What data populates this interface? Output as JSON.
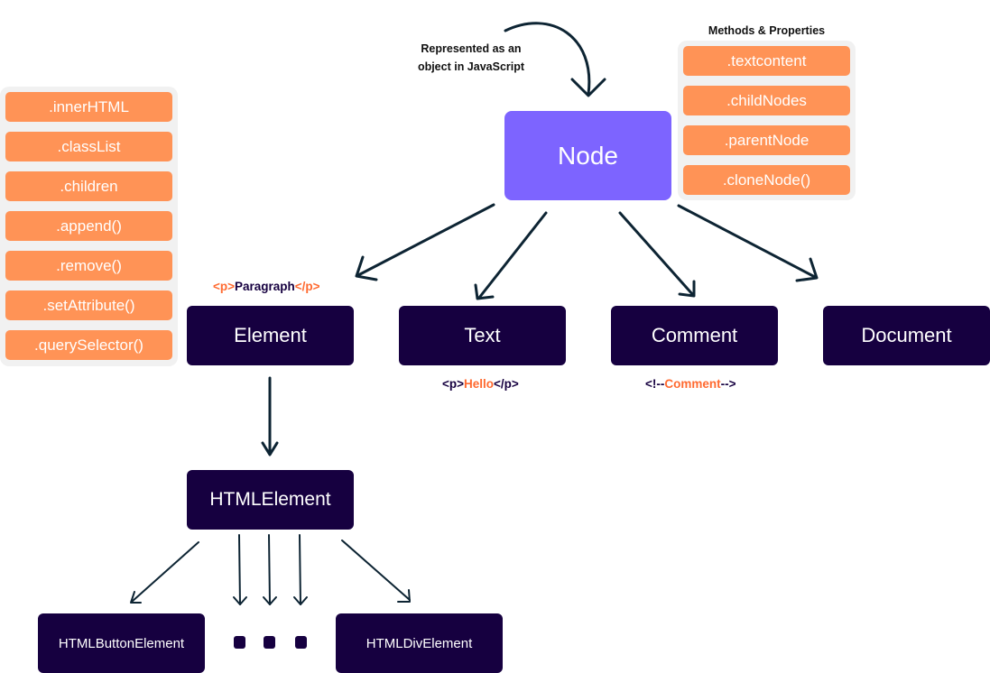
{
  "annotation": {
    "line1": "Represented as an",
    "line2": "object in JavaScript"
  },
  "node": {
    "label": "Node",
    "color": "#7d64ff"
  },
  "node_methods": {
    "title": "Methods & Properties",
    "items": [
      ".textcontent",
      ".childNodes",
      ".parentNode",
      ".cloneNode()"
    ]
  },
  "element_methods": {
    "items": [
      ".innerHTML",
      ".classList",
      ".children",
      ".append()",
      ".remove()",
      ".setAttribute()",
      ".querySelector()"
    ]
  },
  "children": [
    {
      "label": "Element"
    },
    {
      "label": "Text"
    },
    {
      "label": "Comment"
    },
    {
      "label": "Document"
    }
  ],
  "examples": {
    "element": {
      "open": "<p>",
      "content": "Paragraph",
      "close": "</p>"
    },
    "text": {
      "open": "<p>",
      "content": "Hello",
      "close": "</p>"
    },
    "comment": {
      "open": "<!--",
      "content": "Comment",
      "close": "-->"
    }
  },
  "html_element": {
    "label": "HTMLElement"
  },
  "html_subtypes": [
    {
      "label": "HTMLButtonElement"
    },
    {
      "label": "HTMLDivElement"
    }
  ],
  "ellipsis_dots": 3,
  "colors": {
    "dark_box": "#160040",
    "pill": "#ff9356",
    "panel": "#f1f1f1",
    "accent_text": "#ff6a30",
    "arrow": "#0d2433"
  }
}
